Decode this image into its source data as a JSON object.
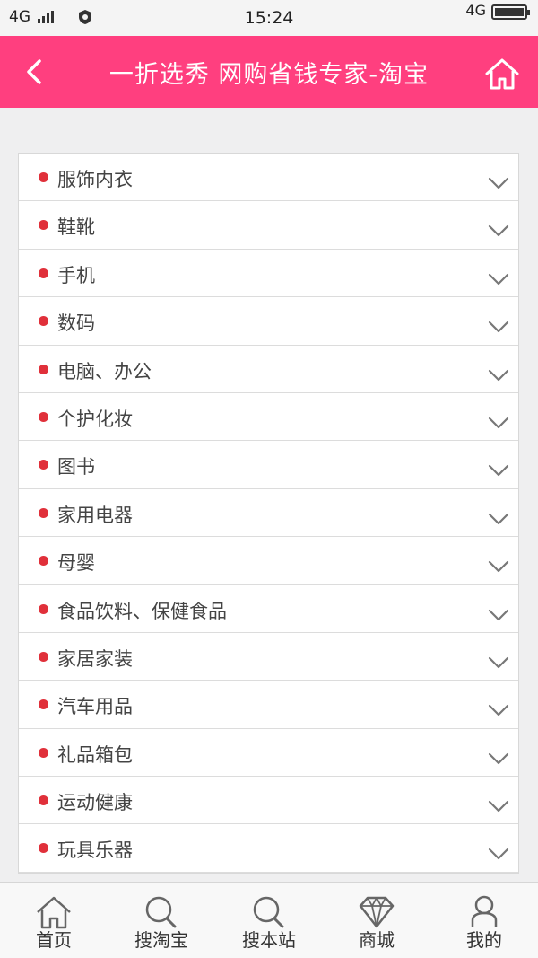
{
  "status_bar": {
    "network_left": "4G",
    "time": "15:24",
    "network_right": "4G",
    "icons": [
      "signal-icon",
      "shield-icon",
      "battery-icon"
    ]
  },
  "header": {
    "title": "一折选秀 网购省钱专家-淘宝",
    "background_color": "#ff3f7f",
    "icons": [
      "back-arrow-icon",
      "home-icon"
    ]
  },
  "categories": [
    "服饰内衣",
    "鞋靴",
    "手机",
    "数码",
    "电脑、办公",
    "个护化妆",
    "图书",
    "家用电器",
    "母婴",
    "食品饮料、保健食品",
    "家居家装",
    "汽车用品",
    "礼品箱包",
    "运动健康",
    "玩具乐器"
  ],
  "bullet_color": "#e0303a",
  "tabbar": {
    "items": [
      {
        "label": "首页",
        "icon": "home-icon"
      },
      {
        "label": "搜淘宝",
        "icon": "search-icon"
      },
      {
        "label": "搜本站",
        "icon": "search-icon"
      },
      {
        "label": "商城",
        "icon": "diamond-icon"
      },
      {
        "label": "我的",
        "icon": "user-icon"
      }
    ]
  }
}
